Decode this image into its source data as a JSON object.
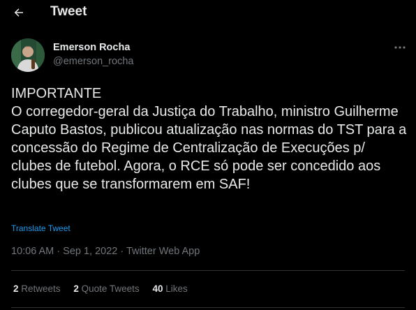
{
  "header": {
    "title": "Tweet",
    "back_icon": "arrow-left-icon"
  },
  "author": {
    "name": "Emerson Rocha",
    "handle": "@emerson_rocha",
    "avatar_icon": "profile-photo"
  },
  "tweet": {
    "text": "IMPORTANTE\nO corregedor-geral da Justiça do Trabalho, ministro Guilherme Caputo Bastos, publicou atualização nas normas do TST para a concessão do Regime de Centralização de Execuções p/ clubes de futebol. Agora, o RCE só pode ser concedido aos clubes que se transformarem em SAF!",
    "translate_label": "Translate Tweet",
    "timestamp": "10:06 AM · Sep 1, 2022 · Twitter Web App"
  },
  "stats": {
    "retweets_count": "2",
    "retweets_label": "Retweets",
    "quotes_count": "2",
    "quotes_label": "Quote Tweets",
    "likes_count": "40",
    "likes_label": "Likes"
  },
  "colors": {
    "background": "#000000",
    "text_primary": "#e7e9ea",
    "text_secondary": "#71767b",
    "link": "#1d9bf0",
    "divider": "#2f3336"
  }
}
